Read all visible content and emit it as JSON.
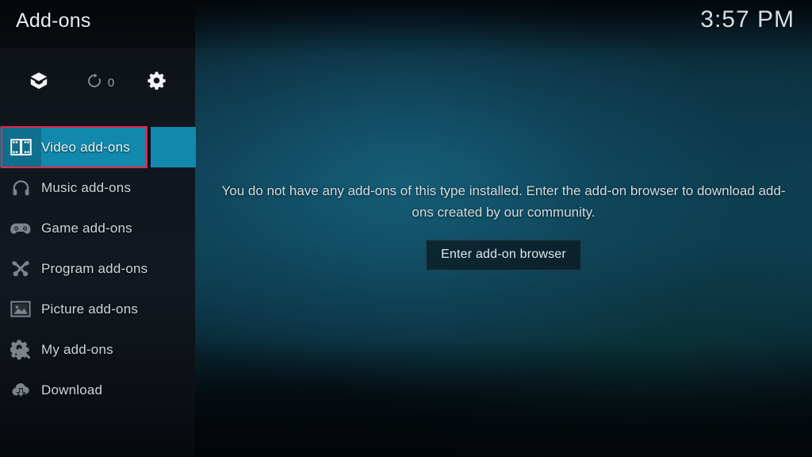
{
  "header": {
    "title": "Add-ons",
    "clock": "3:57 PM"
  },
  "toolbar": {
    "install_from_zip": {
      "label": "install-package",
      "icon": "package-icon"
    },
    "check_updates": {
      "label": "check-for-updates",
      "icon": "refresh-icon",
      "count": "0"
    },
    "settings": {
      "label": "settings",
      "icon": "gear-icon"
    }
  },
  "sidebar": {
    "items": [
      {
        "label": "Video add-ons",
        "icon": "film-strip-icon",
        "selected": true
      },
      {
        "label": "Music add-ons",
        "icon": "headphones-icon",
        "selected": false
      },
      {
        "label": "Game add-ons",
        "icon": "gamepad-icon",
        "selected": false
      },
      {
        "label": "Program add-ons",
        "icon": "tools-icon",
        "selected": false
      },
      {
        "label": "Picture add-ons",
        "icon": "picture-icon",
        "selected": false
      },
      {
        "label": "My add-ons",
        "icon": "gear-wrench-icon",
        "selected": false
      },
      {
        "label": "Download",
        "icon": "cloud-download-icon",
        "selected": false
      }
    ]
  },
  "main": {
    "empty_message": "You do not have any add-ons of this type installed. Enter the add-on browser to download add-ons created by our community.",
    "browser_button": "Enter add-on browser"
  },
  "colors": {
    "highlight": "#1289ac",
    "highlight_icon_block": "#0f6f8c",
    "focus_border": "#e0294a",
    "sidebar_bg": "#10161d",
    "text_primary": "#ced6db"
  }
}
